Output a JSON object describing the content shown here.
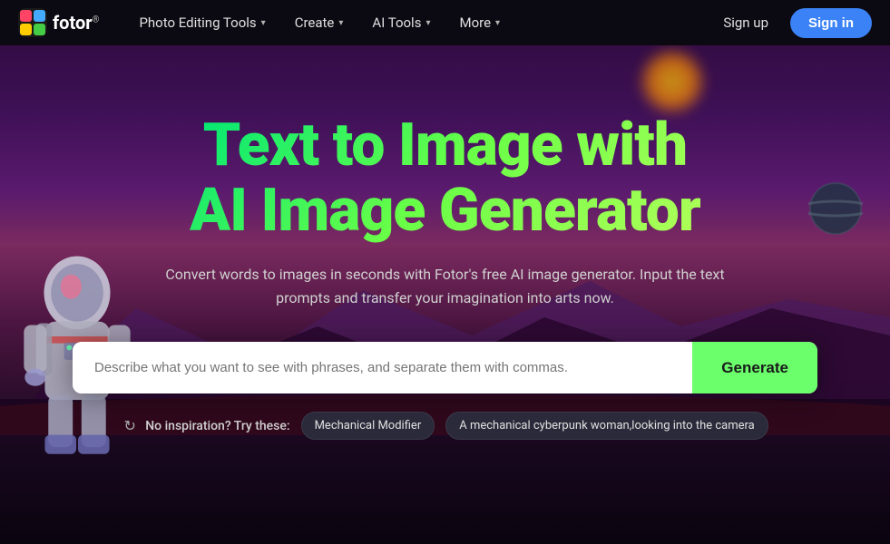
{
  "brand": {
    "name": "fotor",
    "trademark": "®"
  },
  "navbar": {
    "items": [
      {
        "label": "Photo Editing Tools",
        "has_dropdown": true
      },
      {
        "label": "Create",
        "has_dropdown": true
      },
      {
        "label": "AI Tools",
        "has_dropdown": true
      },
      {
        "label": "More",
        "has_dropdown": true
      }
    ],
    "signup_label": "Sign up",
    "signin_label": "Sign in"
  },
  "hero": {
    "title_line1": "Text to Image with",
    "title_line2": "AI Image Generator",
    "subtitle": "Convert words to images in seconds with Fotor's free AI image generator. Input the text prompts and transfer your imagination into arts now.",
    "search_placeholder": "Describe what you want to see with phrases, and separate them with commas.",
    "generate_label": "Generate"
  },
  "inspiration": {
    "label": "No inspiration? Try these:",
    "suggestions": [
      {
        "text": "Mechanical Modifier"
      },
      {
        "text": "A mechanical cyberpunk woman,looking into the camera"
      }
    ]
  }
}
